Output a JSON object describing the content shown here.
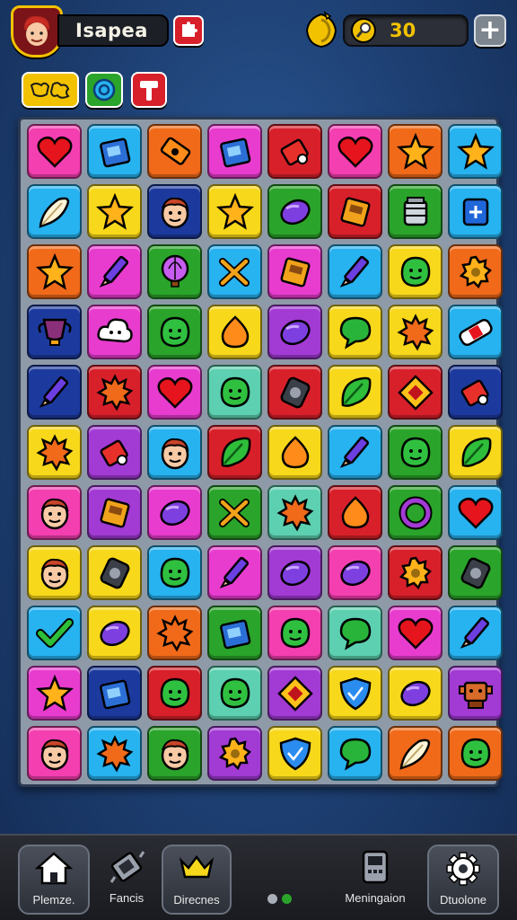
{
  "header": {
    "username": "Isapea",
    "coins": "30",
    "add_label": "+",
    "icons": {
      "avatar": "player-avatar",
      "badge": "puzzle-badge-icon",
      "coin": "gold-coin-icon",
      "search": "magnifier-icon"
    }
  },
  "boosters": [
    {
      "name": "puzzle-pieces-booster",
      "color": "#f2c200"
    },
    {
      "name": "swirl-booster",
      "color": "#2aa42a"
    },
    {
      "name": "hammer-booster",
      "color": "#d8202a"
    }
  ],
  "board": {
    "columns": 8,
    "rows": 11,
    "tiles": [
      [
        "heart",
        "case",
        "ticket",
        "case",
        "tag",
        "heart",
        "star",
        "star"
      ],
      [
        "feather",
        "star",
        "face",
        "star",
        "capsule",
        "book",
        "jar",
        "card"
      ],
      [
        "star",
        "pencil",
        "balloon",
        "cross",
        "book",
        "pencil",
        "blob",
        "gear"
      ],
      [
        "cup",
        "cloud",
        "blob",
        "drop",
        "capsule",
        "chat",
        "splat",
        "bandage"
      ],
      [
        "pencil",
        "splat",
        "heart",
        "blob",
        "phone",
        "leaf",
        "diamond",
        "tag"
      ],
      [
        "splat",
        "tag",
        "face",
        "leaf",
        "drop",
        "pencil",
        "blob",
        "leaf"
      ],
      [
        "face",
        "book",
        "capsule",
        "cross",
        "splat",
        "drop",
        "ring",
        "heart"
      ],
      [
        "face",
        "phone",
        "blob",
        "pencil",
        "capsule",
        "capsule",
        "gear",
        "phone"
      ],
      [
        "check",
        "capsule",
        "splat",
        "case",
        "blob",
        "chat",
        "heart",
        "pencil"
      ],
      [
        "star",
        "case",
        "blob",
        "blob",
        "diamond",
        "shield",
        "capsule",
        "robot"
      ],
      [
        "face",
        "splat",
        "face",
        "gear",
        "shield",
        "chat",
        "feather",
        "blob"
      ]
    ],
    "colors": [
      [
        "#f43fb0",
        "#27b2f0",
        "#f06a1a",
        "#e83ccf",
        "#d8202a",
        "#f43fb0",
        "#f06a1a",
        "#27b2f0"
      ],
      [
        "#27b2f0",
        "#f8d81a",
        "#1c3a9e",
        "#f8d81a",
        "#2aa42a",
        "#d8202a",
        "#2aa42a",
        "#27b2f0"
      ],
      [
        "#f06a1a",
        "#e83ccf",
        "#2aa42a",
        "#27b2f0",
        "#e83ccf",
        "#27b2f0",
        "#f8d81a",
        "#f06a1a"
      ],
      [
        "#1c3a9e",
        "#e83ccf",
        "#2aa42a",
        "#f8d81a",
        "#a23ad4",
        "#f8d81a",
        "#f8d81a",
        "#27b2f0"
      ],
      [
        "#1c3a9e",
        "#d8202a",
        "#e83ccf",
        "#5cd0b0",
        "#d8202a",
        "#f8d81a",
        "#d8202a",
        "#1c3a9e"
      ],
      [
        "#f8d81a",
        "#a23ad4",
        "#27b2f0",
        "#d8202a",
        "#f8d81a",
        "#27b2f0",
        "#2aa42a",
        "#f8d81a"
      ],
      [
        "#f43fb0",
        "#a23ad4",
        "#e83ccf",
        "#2aa42a",
        "#5cd0b0",
        "#d8202a",
        "#2aa42a",
        "#27b2f0"
      ],
      [
        "#f8d81a",
        "#f8d81a",
        "#27b2f0",
        "#e83ccf",
        "#a23ad4",
        "#f43fb0",
        "#d8202a",
        "#2aa42a"
      ],
      [
        "#27b2f0",
        "#f8d81a",
        "#f06a1a",
        "#2aa42a",
        "#f43fb0",
        "#5cd0b0",
        "#e83ccf",
        "#27b2f0"
      ],
      [
        "#e83ccf",
        "#1c3a9e",
        "#d8202a",
        "#5cd0b0",
        "#a23ad4",
        "#f8d81a",
        "#f8d81a",
        "#a23ad4"
      ],
      [
        "#f43fb0",
        "#27b2f0",
        "#2aa42a",
        "#a23ad4",
        "#f8d81a",
        "#27b2f0",
        "#f06a1a",
        "#f06a1a"
      ]
    ]
  },
  "nav": [
    {
      "label": "Plemze.",
      "icon": "home-icon"
    },
    {
      "label": "Fancis",
      "icon": "gamepad-icon"
    },
    {
      "label": "Direcnes",
      "icon": "crown-icon"
    },
    {
      "label": "Meningaion",
      "icon": "calculator-icon"
    },
    {
      "label": "Dtuolone",
      "icon": "settings-icon"
    }
  ],
  "pager": {
    "active_color": "#2aa42a",
    "inactive_color": "#aab0ba"
  }
}
